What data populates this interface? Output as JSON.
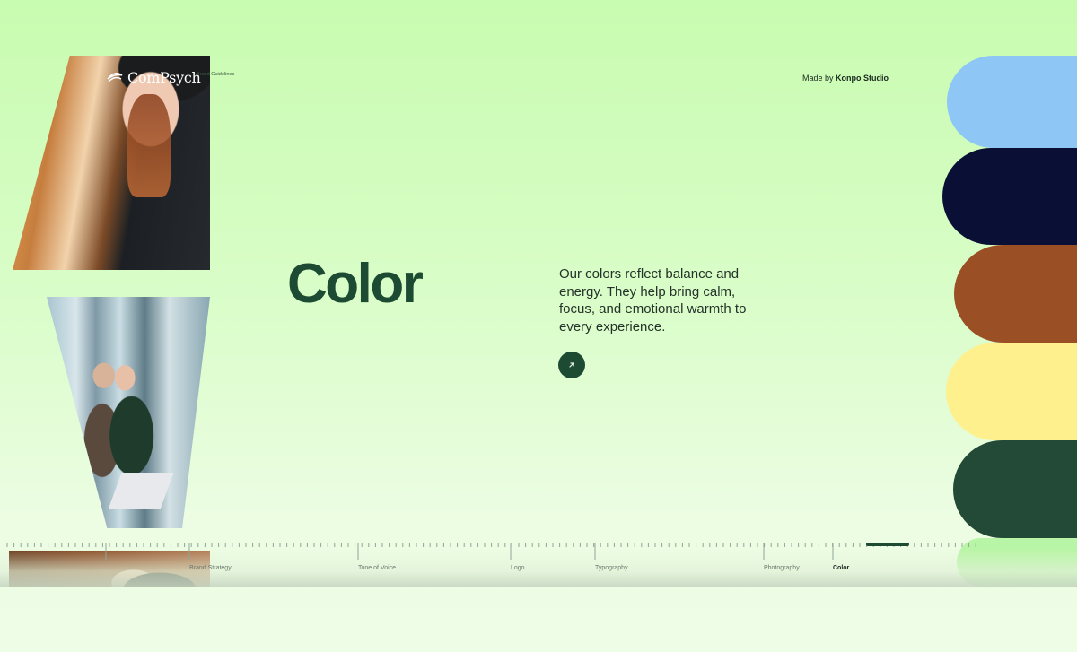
{
  "brand": {
    "name": "ComPsych",
    "subtitle": "Brand Guidelines"
  },
  "header": {
    "made_by_prefix": "Made by",
    "made_by_studio": "Konpo Studio"
  },
  "hero": {
    "title": "Color",
    "description": "Our colors reflect balance and energy. They help bring calm, focus, and emotional warmth to every experience."
  },
  "palette": [
    {
      "name": "Light Blue",
      "hex": "#8ec6f5"
    },
    {
      "name": "Navy",
      "hex": "#0a0f35"
    },
    {
      "name": "Rust",
      "hex": "#9b4f25"
    },
    {
      "name": "Light Yellow",
      "hex": "#fff08e"
    },
    {
      "name": "Forest Green",
      "hex": "#234a36"
    },
    {
      "name": "Mint",
      "hex": "#b9f5a6"
    }
  ],
  "nav": {
    "items": [
      {
        "label": "Brand Strategy"
      },
      {
        "label": "Tone of Voice"
      },
      {
        "label": "Logo"
      },
      {
        "label": "Typography"
      },
      {
        "label": "Photography"
      },
      {
        "label": "Color",
        "active": true
      }
    ]
  },
  "colors": {
    "accent": "#1d4a33",
    "text": "#243229"
  },
  "icons": {
    "menu": "more-vertical-icon",
    "arrow": "arrow-up-right-icon",
    "logo": "leaf-mark-icon"
  }
}
